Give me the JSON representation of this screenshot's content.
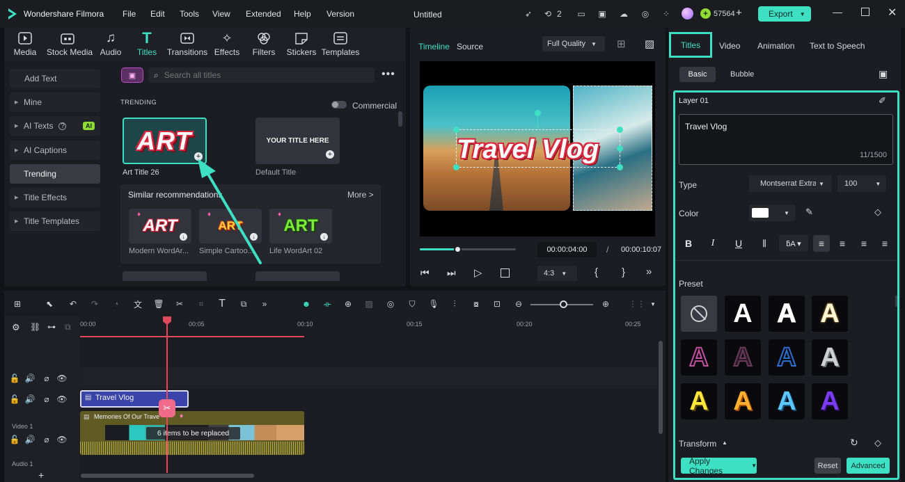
{
  "app": {
    "name": "Wondershare Filmora",
    "doc_title": "Untitled",
    "menu": [
      "File",
      "Edit",
      "Tools",
      "View",
      "Extended",
      "Help",
      "Version"
    ],
    "counter": "2",
    "credits": "57564",
    "export_label": "Export",
    "accent": "#3ee0c4"
  },
  "toolbar": {
    "items": [
      "Media",
      "Stock Media",
      "Audio",
      "Titles",
      "Transitions",
      "Effects",
      "Filters",
      "Stickers",
      "Templates"
    ]
  },
  "sidebar": {
    "items": [
      {
        "label": "Add Text"
      },
      {
        "label": "Mine"
      },
      {
        "label": "AI Texts",
        "badge": "AI"
      },
      {
        "label": "AI Captions"
      },
      {
        "label": "Trending"
      },
      {
        "label": "Title Effects"
      },
      {
        "label": "Title Templates"
      }
    ]
  },
  "library": {
    "search_placeholder": "Search all titles",
    "section": "TRENDING",
    "commercial": "Commercial",
    "cards": [
      {
        "thumb_text": "ART",
        "label": "Art Title 26"
      },
      {
        "thumb_text": "YOUR TITLE HERE",
        "label": "Default Title"
      }
    ],
    "similar": {
      "title": "Similar recommendations",
      "more": "More >",
      "items": [
        {
          "thumb": "ART",
          "label": "Modern WordAr..."
        },
        {
          "thumb": "ART",
          "label": "Simple Cartoo..."
        },
        {
          "thumb": "ART",
          "label": "Life WordArt 02"
        }
      ]
    }
  },
  "preview": {
    "tabs": [
      "Timeline",
      "Source"
    ],
    "quality": "Full Quality",
    "overlay_text": "Travel Vlog",
    "current_time": "00:00:04:00",
    "total_time": "00:00:10:07",
    "aspect": "4:3",
    "progress": 0.4,
    "brace_open": "{",
    "brace_close": "}"
  },
  "props": {
    "tabs": [
      "Titles",
      "Video",
      "Animation",
      "Text to Speech"
    ],
    "subtabs": [
      "Basic",
      "Bubble"
    ],
    "layer": "Layer 01",
    "text_value": "Travel Vlog",
    "char_count": "11/1500",
    "type_label": "Type",
    "font": "Montserrat Extra",
    "size": "100",
    "color_label": "Color",
    "preset_label": "Preset",
    "transform_label": "Transform",
    "apply": "Apply Changes",
    "reset": "Reset",
    "advanced": "Advanced",
    "preset_letter": "A"
  },
  "timeline": {
    "ruler": [
      "00:00",
      "00:05",
      "00:10",
      "00:15",
      "00:20",
      "00:25"
    ],
    "title_clip": "Travel Vlog",
    "video_clip": "Memories Of Our Trave",
    "replace_text": "6 items to be replaced",
    "track_video": "Video 1",
    "track_audio": "Audio 1",
    "plus": "+"
  }
}
